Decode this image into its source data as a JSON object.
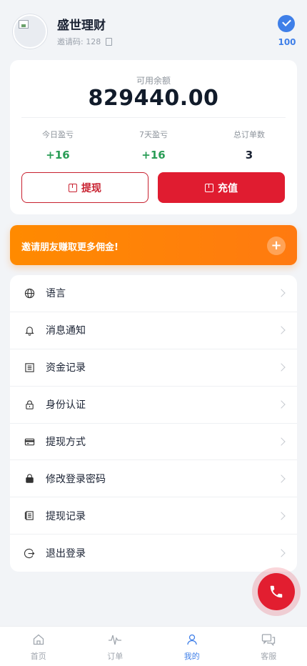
{
  "profile": {
    "name": "盛世理财",
    "invite_label": "邀请码: 128",
    "score": "100"
  },
  "balance": {
    "label": "可用余额",
    "value": "829440.00"
  },
  "stats": [
    {
      "label": "今日盈亏",
      "value": "+16"
    },
    {
      "label": "7天盈亏",
      "value": "+16"
    },
    {
      "label": "总订单数",
      "value": "3"
    }
  ],
  "actions": {
    "withdraw": "提现",
    "recharge": "充值"
  },
  "promo": {
    "text": "邀请朋友赚取更多佣金!",
    "plus": "+"
  },
  "menu": [
    {
      "label": "语言",
      "icon": "globe-icon"
    },
    {
      "label": "消息通知",
      "icon": "bell-icon"
    },
    {
      "label": "资金记录",
      "icon": "list-icon"
    },
    {
      "label": "身份认证",
      "icon": "lock-outline-icon"
    },
    {
      "label": "提现方式",
      "icon": "card-icon"
    },
    {
      "label": "修改登录密码",
      "icon": "lock-solid-icon"
    },
    {
      "label": "提现记录",
      "icon": "record-icon"
    },
    {
      "label": "退出登录",
      "icon": "logout-icon"
    }
  ],
  "nav": [
    {
      "label": "首页",
      "icon": "home-icon"
    },
    {
      "label": "订单",
      "icon": "pulse-icon"
    },
    {
      "label": "我的",
      "icon": "user-icon",
      "active": true
    },
    {
      "label": "客服",
      "icon": "chat-icon"
    }
  ],
  "colors": {
    "accent": "#3f7fe8",
    "brand_red": "#e01c30",
    "positive": "#2a9d56",
    "promo": "#ff8a00"
  }
}
